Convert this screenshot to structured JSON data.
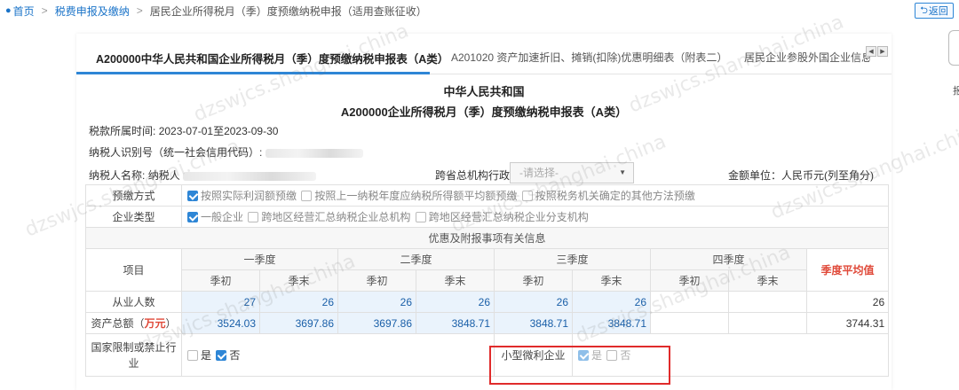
{
  "breadcrumb": {
    "home": "首页",
    "level1": "税费申报及缴纳",
    "current": "居民企业所得税月（季）度预缴纳税申报（适用查账征收）"
  },
  "back_label": "返回",
  "tabs": [
    {
      "label": "A200000中华人民共和国企业所得税月（季）度预缴纳税申报表（A类）"
    },
    {
      "label": "A201020 资产加速折旧、摊销(扣除)优惠明细表（附表二）"
    },
    {
      "label": "居民企业参股外国企业信息..."
    }
  ],
  "right_edge_char": "报",
  "form": {
    "title1": "中华人民共和国",
    "title2": "A200000企业所得税月（季）度预缴纳税申报表（A类）",
    "period_label": "税款所属时间:",
    "period_value": "2023-07-01至2023-09-30",
    "taxid_label": "纳税人识别号（统一社会信用代码）:",
    "name_label": "纳税人名称:",
    "name_value": "纳税人",
    "cross_region_label": "跨省总机构行政区划:",
    "cross_region_placeholder": "-请选择-",
    "unit_label": "金额单位：人民币元(列至角分)"
  },
  "prepay_method": {
    "label": "预缴方式",
    "options": [
      {
        "text": "按照实际利润额预缴",
        "checked": true
      },
      {
        "text": "按照上一纳税年度应纳税所得额平均额预缴",
        "checked": false
      },
      {
        "text": "按照税务机关确定的其他方法预缴",
        "checked": false
      }
    ]
  },
  "company_type": {
    "label": "企业类型",
    "options": [
      {
        "text": "一般企业",
        "checked": true
      },
      {
        "text": "跨地区经营汇总纳税企业总机构",
        "checked": false
      },
      {
        "text": "跨地区经营汇总纳税企业分支机构",
        "checked": false
      }
    ]
  },
  "info_section": {
    "title": "优惠及附报事项有关信息",
    "item_header": "项目",
    "quarters": [
      "一季度",
      "二季度",
      "三季度",
      "四季度"
    ],
    "sub_start": "季初",
    "sub_end": "季末",
    "avg_header": "季度平均值",
    "rows": [
      {
        "label": "从业人数",
        "unit": "",
        "values": [
          "27",
          "26",
          "26",
          "26",
          "26",
          "26",
          "",
          ""
        ],
        "avg": "26"
      },
      {
        "label": "资产总额（",
        "unit": "万元",
        "label_end": "）",
        "values": [
          "3524.03",
          "3697.86",
          "3697.86",
          "3848.71",
          "3848.71",
          "3848.71",
          "",
          ""
        ],
        "avg": "3744.31"
      }
    ],
    "restricted_industry": {
      "label": "国家限制或禁止行业",
      "yes": "是",
      "no": "否",
      "yes_checked": false,
      "no_checked": true
    },
    "small_micro": {
      "label": "小型微利企业",
      "yes": "是",
      "no": "否",
      "yes_checked": true,
      "no_checked": false
    }
  },
  "watermark": "dzswjcs.shanghai.china"
}
